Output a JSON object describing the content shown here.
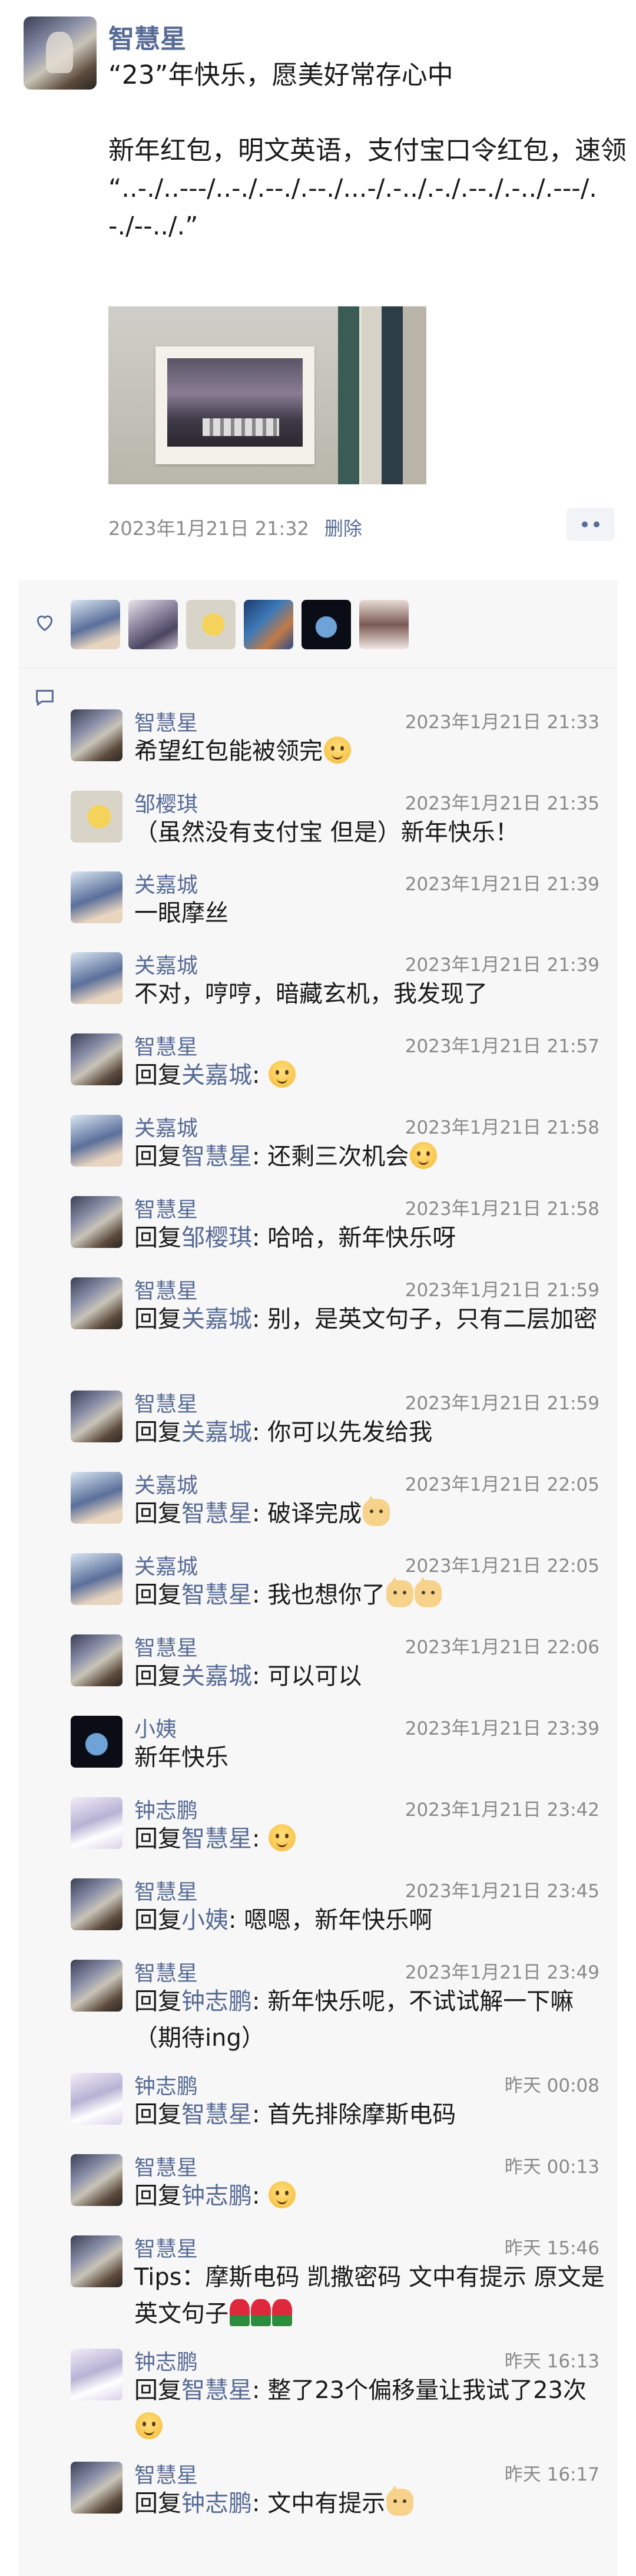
{
  "post": {
    "author": "智慧星",
    "text_lines": [
      "“23”年快乐，愿美好常存心中",
      "",
      "新年红包，明文英语，支付宝口令红包，速领"
    ],
    "morse": "“..-./..---/..-./.--./.--./...-/.-../.-./.--./.-../.---/.-./--../.”",
    "timestamp": "2023年1月21日 21:32",
    "delete_label": "删除"
  },
  "likes": {
    "icon": "heart-icon",
    "count_shown": 6
  },
  "comments": [
    {
      "name": "智慧星",
      "time": "2023年1月21日 21:33",
      "text": "希望红包能被领完",
      "emoji": [
        "face"
      ]
    },
    {
      "name": "邹樱琪",
      "time": "2023年1月21日 21:35",
      "text": "（虽然没有支付宝 但是）新年快乐！",
      "emoji": []
    },
    {
      "name": "关嘉城",
      "time": "2023年1月21日 21:39",
      "text": "一眼摩丝",
      "emoji": []
    },
    {
      "name": "关嘉城",
      "time": "2023年1月21日 21:39",
      "text": "不对，哼哼，暗藏玄机，我发现了",
      "emoji": []
    },
    {
      "name": "智慧星",
      "time": "2023年1月21日 21:57",
      "reply_prefix": "回复",
      "reply_to": "关嘉城",
      "text": ": ",
      "emoji": [
        "face"
      ]
    },
    {
      "name": "关嘉城",
      "time": "2023年1月21日 21:58",
      "reply_prefix": "回复",
      "reply_to": "智慧星",
      "text": ": 还剩三次机会",
      "emoji": [
        "face"
      ]
    },
    {
      "name": "智慧星",
      "time": "2023年1月21日 21:58",
      "reply_prefix": "回复",
      "reply_to": "邹樱琪",
      "text": ": 哈哈，新年快乐呀",
      "emoji": []
    },
    {
      "name": "智慧星",
      "time": "2023年1月21日 21:59",
      "reply_prefix": "回复",
      "reply_to": "关嘉城",
      "text": ": 别，是英文句子，只有二层加密",
      "emoji": []
    },
    {
      "name": "智慧星",
      "time": "2023年1月21日 21:59",
      "reply_prefix": "回复",
      "reply_to": "关嘉城",
      "text": ": 你可以先发给我",
      "emoji": []
    },
    {
      "name": "关嘉城",
      "time": "2023年1月21日 22:05",
      "reply_prefix": "回复",
      "reply_to": "智慧星",
      "text": ": 破译完成",
      "emoji": [
        "cat"
      ]
    },
    {
      "name": "关嘉城",
      "time": "2023年1月21日 22:05",
      "reply_prefix": "回复",
      "reply_to": "智慧星",
      "text": ": 我也想你了",
      "emoji": [
        "cat",
        "cat"
      ]
    },
    {
      "name": "智慧星",
      "time": "2023年1月21日 22:06",
      "reply_prefix": "回复",
      "reply_to": "关嘉城",
      "text": ": 可以可以",
      "emoji": []
    },
    {
      "name": "小姨",
      "time": "2023年1月21日 23:39",
      "text": "新年快乐",
      "emoji": []
    },
    {
      "name": "钟志鹏",
      "time": "2023年1月21日 23:42",
      "reply_prefix": "回复",
      "reply_to": "智慧星",
      "text": ": ",
      "emoji": [
        "face"
      ]
    },
    {
      "name": "智慧星",
      "time": "2023年1月21日 23:45",
      "reply_prefix": "回复",
      "reply_to": "小姨",
      "text": ": 嗯嗯，新年快乐啊",
      "emoji": []
    },
    {
      "name": "智慧星",
      "time": "2023年1月21日 23:49",
      "reply_prefix": "回复",
      "reply_to": "钟志鹏",
      "text": ": 新年快乐呢，不试试解一下嘛（期待ing）",
      "emoji": []
    },
    {
      "name": "钟志鹏",
      "time": "昨天 00:08",
      "reply_prefix": "回复",
      "reply_to": "智慧星",
      "text": ": 首先排除摩斯电码",
      "emoji": []
    },
    {
      "name": "智慧星",
      "time": "昨天 00:13",
      "reply_prefix": "回复",
      "reply_to": "钟志鹏",
      "text": ": ",
      "emoji": [
        "face"
      ]
    },
    {
      "name": "智慧星",
      "time": "昨天 15:46",
      "text": "Tips：摩斯电码 凯撒密码 文中有提示 原文是英文句子",
      "emoji": [
        "rose",
        "rose",
        "rose"
      ]
    },
    {
      "name": "钟志鹏",
      "time": "昨天 16:13",
      "reply_prefix": "回复",
      "reply_to": "智慧星",
      "text": ": 整了23个偏移量让我试了23次",
      "emoji": [
        "face"
      ]
    },
    {
      "name": "智慧星",
      "time": "昨天 16:17",
      "reply_prefix": "回复",
      "reply_to": "钟志鹏",
      "text": ": 文中有提示",
      "emoji": [
        "cat"
      ]
    }
  ],
  "colors": {
    "link": "#576b95",
    "meta": "#8a8a8a",
    "panel": "#f7f7f7"
  }
}
